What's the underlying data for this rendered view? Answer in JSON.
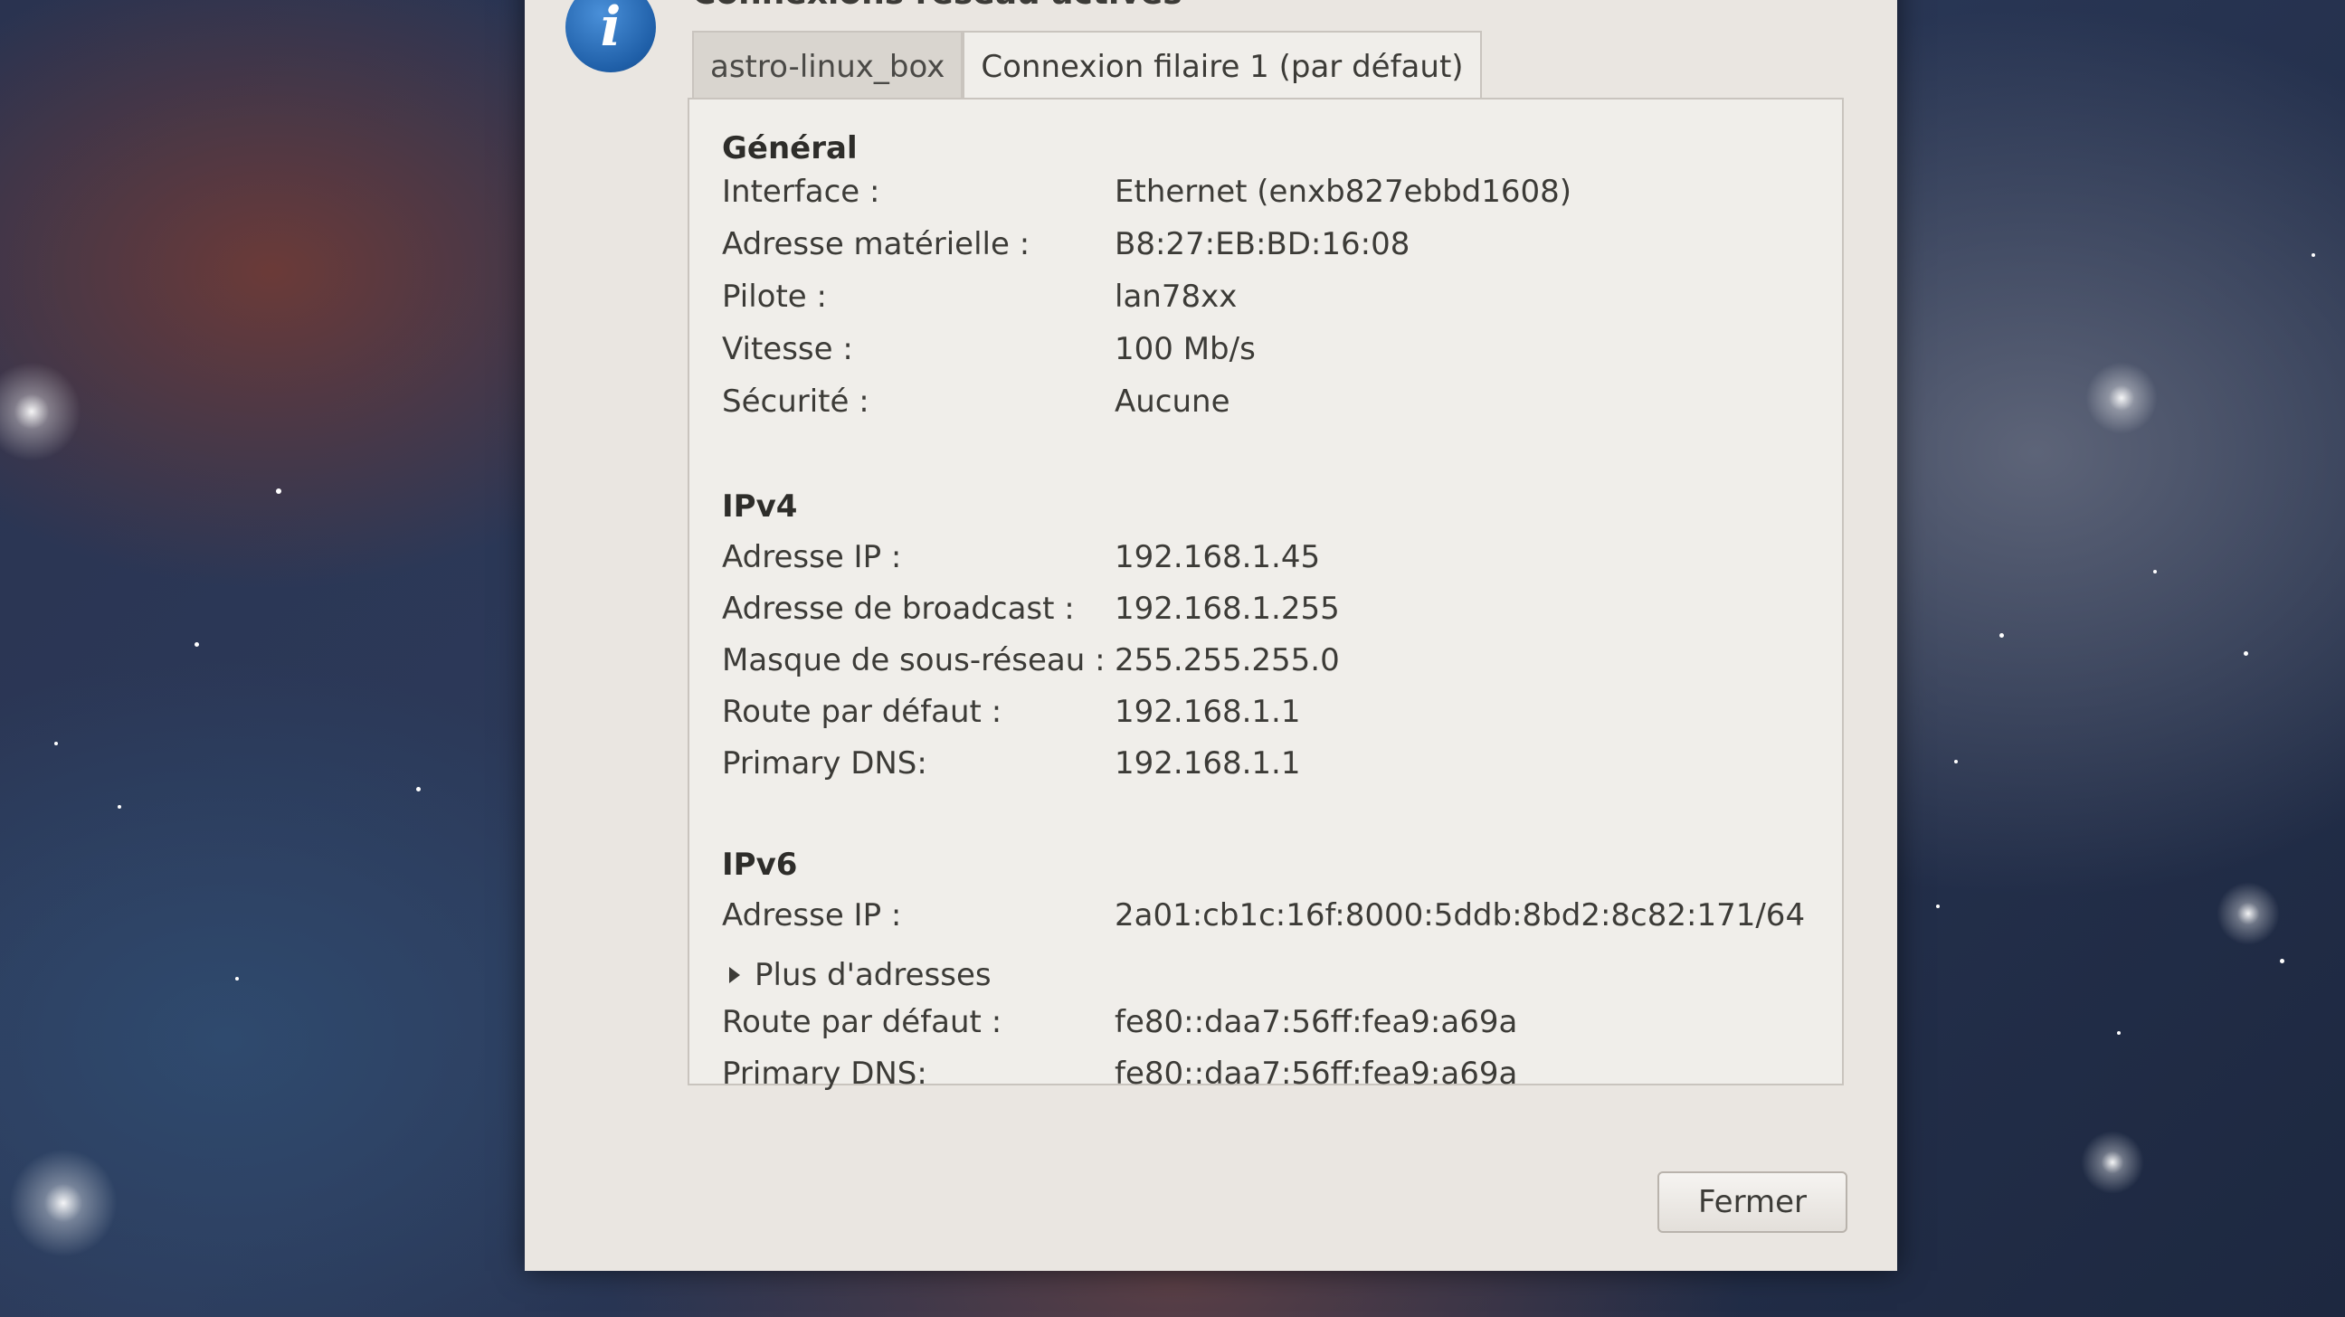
{
  "dialog": {
    "title": "Connexions réseau actives",
    "tabs": [
      {
        "label": "astro-linux_box"
      },
      {
        "label": "Connexion filaire 1 (par défaut)"
      }
    ],
    "general": {
      "heading": "Général",
      "rows": [
        {
          "label": "Interface :",
          "value": "Ethernet (enxb827ebbd1608)"
        },
        {
          "label": "Adresse matérielle :",
          "value": "B8:27:EB:BD:16:08"
        },
        {
          "label": "Pilote :",
          "value": "lan78xx"
        },
        {
          "label": "Vitesse :",
          "value": "100 Mb/s"
        },
        {
          "label": "Sécurité :",
          "value": "Aucune"
        }
      ]
    },
    "ipv4": {
      "heading": "IPv4",
      "rows": [
        {
          "label": "Adresse IP :",
          "value": "192.168.1.45"
        },
        {
          "label": "Adresse de broadcast :",
          "value": "192.168.1.255"
        },
        {
          "label": "Masque de sous-réseau :",
          "value": "255.255.255.0"
        },
        {
          "label": "Route par défaut :",
          "value": "192.168.1.1"
        },
        {
          "label": "Primary DNS:",
          "value": "192.168.1.1"
        }
      ]
    },
    "ipv6": {
      "heading": "IPv6",
      "address_label": "Adresse IP :",
      "address_value": "2a01:cb1c:16f:8000:5ddb:8bd2:8c82:171/64",
      "more_addresses": "Plus d'adresses",
      "rows": [
        {
          "label": "Route par défaut :",
          "value": "fe80::daa7:56ff:fea9:a69a"
        },
        {
          "label": "Primary DNS:",
          "value": "fe80::daa7:56ff:fea9:a69a"
        }
      ]
    },
    "close_label": "Fermer"
  }
}
